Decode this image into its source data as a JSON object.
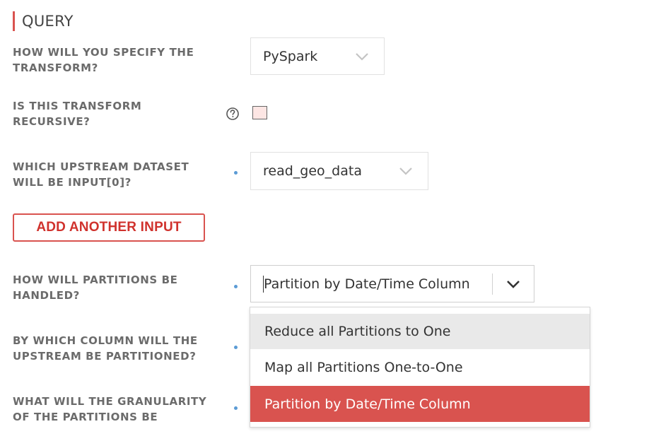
{
  "section": {
    "title": "QUERY"
  },
  "fields": {
    "transform_spec": {
      "label": "HOW WILL YOU SPECIFY THE\nTRANSFORM?",
      "value": "PySpark"
    },
    "recursive": {
      "label": "IS THIS TRANSFORM\nRECURSIVE?",
      "checked": false
    },
    "upstream_input": {
      "label": "WHICH UPSTREAM DATASET\nWILL BE INPUT[0]?",
      "value": "read_geo_data"
    },
    "add_input": {
      "label": "ADD ANOTHER INPUT"
    },
    "partitions": {
      "label": "HOW WILL PARTITIONS BE\nHANDLED?",
      "value": "Partition by Date/Time Column",
      "options": [
        "Reduce all Partitions to One",
        "Map all Partitions One-to-One",
        "Partition by Date/Time Column"
      ],
      "selected_option": "Partition by Date/Time Column",
      "hovered_option": "Reduce all Partitions to One"
    },
    "partition_column": {
      "label": "BY WHICH COLUMN WILL THE\nUPSTREAM BE PARTITIONED?"
    },
    "granularity": {
      "label": "WHAT WILL THE GRANULARITY\nOF THE PARTITIONS BE"
    }
  },
  "icons": {
    "help": "question-circle-icon",
    "chevron": "chevron-down-icon",
    "required": "required-dot-icon"
  },
  "colors": {
    "accent": "#d9534f",
    "label": "#6b6b6b",
    "required_dot": "#5b9bd5",
    "hover_bg": "#e9e9e9",
    "checkbox_bg": "#fde6e4"
  }
}
